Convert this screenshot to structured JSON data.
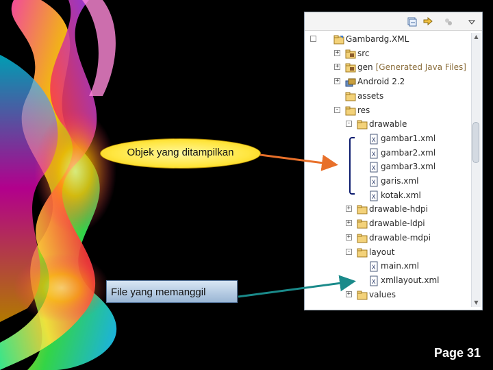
{
  "callouts": {
    "objek": "Objek yang ditampilkan",
    "file": "File yang memanggil"
  },
  "page_label": "Page 31",
  "tree": {
    "items": [
      {
        "label": "Gambardg.XML",
        "icon": "project-icon"
      },
      {
        "label": "src",
        "icon": "source-folder-icon"
      },
      {
        "label": "gen",
        "decoration": "[Generated Java Files]",
        "icon": "source-folder-icon"
      },
      {
        "label": "Android 2.2",
        "icon": "library-icon"
      },
      {
        "label": "assets",
        "icon": "folder-icon"
      },
      {
        "label": "res",
        "icon": "folder-icon"
      },
      {
        "label": "drawable",
        "icon": "folder-icon"
      },
      {
        "label": "gambar1.xml",
        "icon": "xml-file-icon"
      },
      {
        "label": "gambar2.xml",
        "icon": "xml-file-icon"
      },
      {
        "label": "gambar3.xml",
        "icon": "xml-file-icon"
      },
      {
        "label": "garis.xml",
        "icon": "xml-file-icon"
      },
      {
        "label": "kotak.xml",
        "icon": "xml-file-icon"
      },
      {
        "label": "drawable-hdpi",
        "icon": "folder-icon"
      },
      {
        "label": "drawable-ldpi",
        "icon": "folder-icon"
      },
      {
        "label": "drawable-mdpi",
        "icon": "folder-icon"
      },
      {
        "label": "layout",
        "icon": "folder-icon"
      },
      {
        "label": "main.xml",
        "icon": "xml-file-icon"
      },
      {
        "label": "xmllayout.xml",
        "icon": "xml-file-icon"
      },
      {
        "label": "values",
        "icon": "folder-icon"
      }
    ]
  },
  "colors": {
    "arrow_orange": "#e8702a",
    "arrow_teal": "#1a8a8a",
    "bracket": "#0b1b6e",
    "callout_yellow": "#ffe640",
    "callout_blue": "#9ab6d4"
  }
}
